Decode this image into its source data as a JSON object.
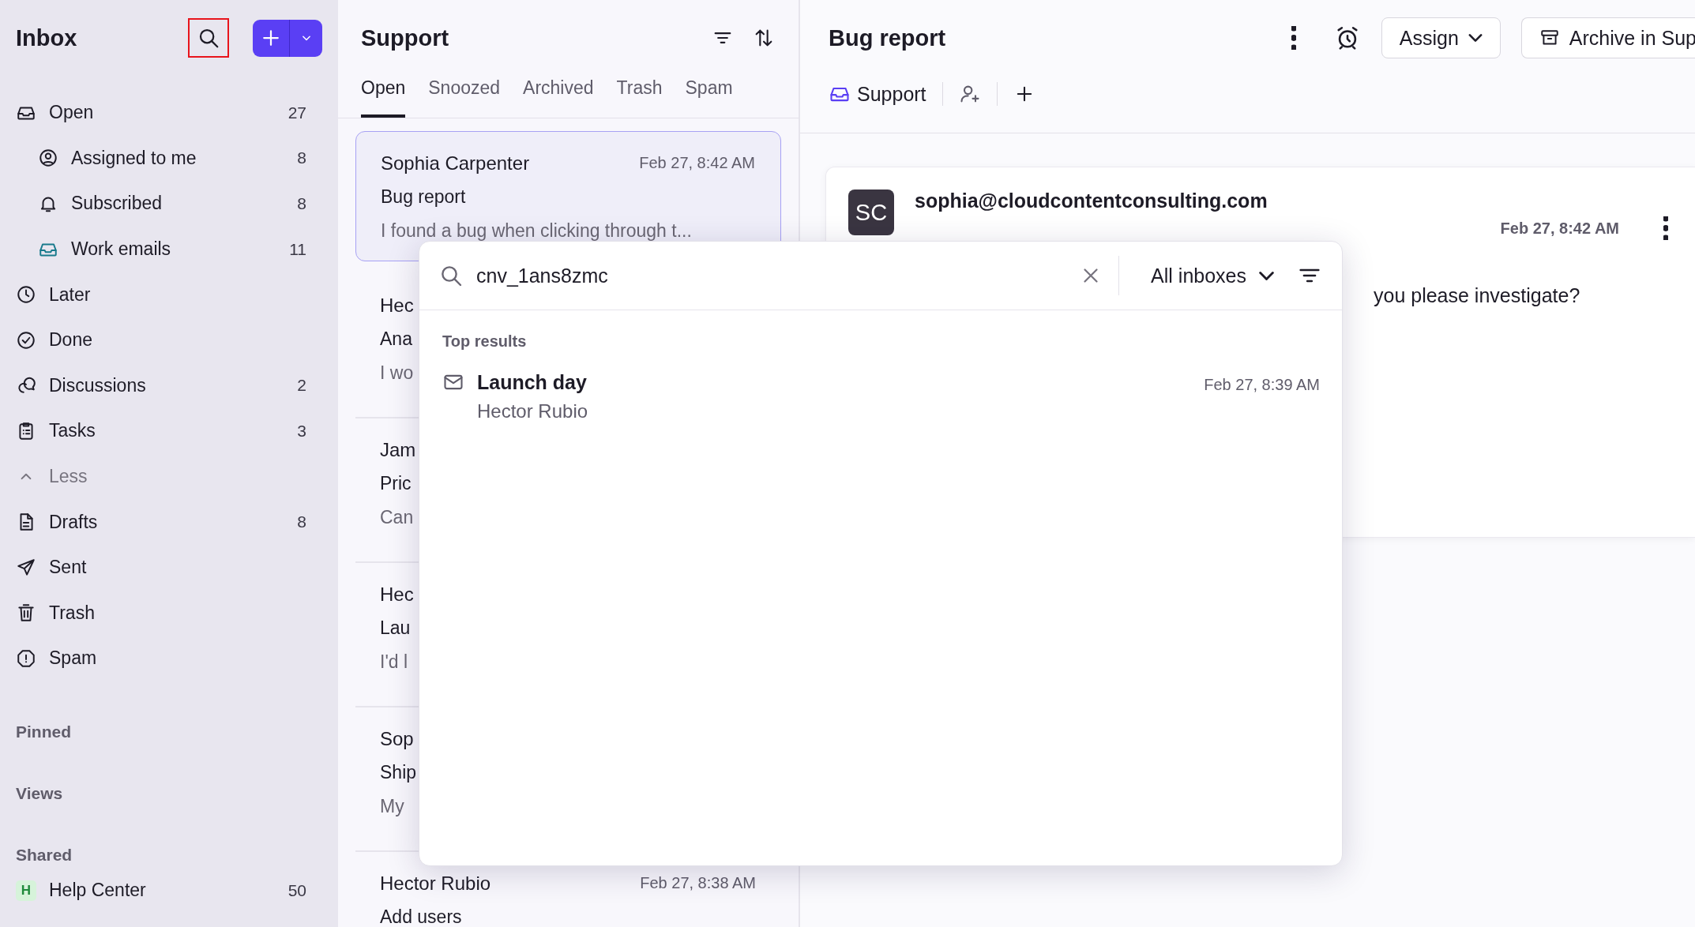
{
  "sidebar": {
    "title": "Inbox",
    "search_highlighted": true,
    "nav": [
      {
        "label": "Open",
        "count": "27",
        "children": [
          {
            "label": "Assigned to me",
            "count": "8"
          },
          {
            "label": "Subscribed",
            "count": "8"
          },
          {
            "label": "Work emails",
            "count": "11"
          }
        ]
      },
      {
        "label": "Later"
      },
      {
        "label": "Done"
      },
      {
        "label": "Discussions",
        "count": "2"
      },
      {
        "label": "Tasks",
        "count": "3"
      },
      {
        "label": "Less",
        "kind": "toggle",
        "expanded": true
      },
      {
        "label": "Drafts",
        "count": "8"
      },
      {
        "label": "Sent"
      },
      {
        "label": "Trash"
      },
      {
        "label": "Spam"
      }
    ],
    "sections": [
      {
        "title": "Pinned"
      },
      {
        "title": "Views"
      },
      {
        "title": "Shared",
        "items": [
          {
            "badge": "H",
            "color": "#1f8a3b",
            "label": "Help Center",
            "count": "50"
          }
        ]
      }
    ]
  },
  "list": {
    "title": "Support",
    "tabs": [
      {
        "label": "Open",
        "selected": true
      },
      {
        "label": "Snoozed",
        "selected": false
      },
      {
        "label": "Archived",
        "selected": false
      },
      {
        "label": "Trash",
        "selected": false
      },
      {
        "label": "Spam",
        "selected": false
      }
    ],
    "conversations": [
      {
        "sender": "Sophia Carpenter",
        "time": "Feb 27, 8:42 AM",
        "subject": "Bug report",
        "preview": "I found a bug when clicking through t...",
        "selected": true
      },
      {
        "sender": "Hec",
        "subject": "Ana",
        "preview": "I wo",
        "selected": false
      },
      {
        "sender": "Jam",
        "subject": "Pric",
        "preview": "Can",
        "selected": false
      },
      {
        "sender": "Hec",
        "subject": "Lau",
        "preview": "I'd l",
        "selected": false
      },
      {
        "sender": "Sop",
        "subject": "Ship",
        "preview": "My",
        "selected": false
      },
      {
        "sender": "Hector Rubio",
        "time": "Feb 27, 8:38 AM",
        "subject": "Add users",
        "selected": false
      }
    ]
  },
  "detail": {
    "title": "Bug report",
    "assign": "Assign",
    "archive": "Archive in Sup",
    "tag": "Support",
    "message": {
      "avatar": "SC",
      "from": "sophia@cloudcontentconsulting.com",
      "time": "Feb 27, 8:42 AM",
      "body": "you please investigate?"
    }
  },
  "search": {
    "query": "cnv_1ans8zmc",
    "scope": "All inboxes",
    "section": "Top results",
    "results": [
      {
        "title": "Launch day",
        "sender": "Hector Rubio",
        "time": "Feb 27, 8:39 AM"
      }
    ]
  }
}
